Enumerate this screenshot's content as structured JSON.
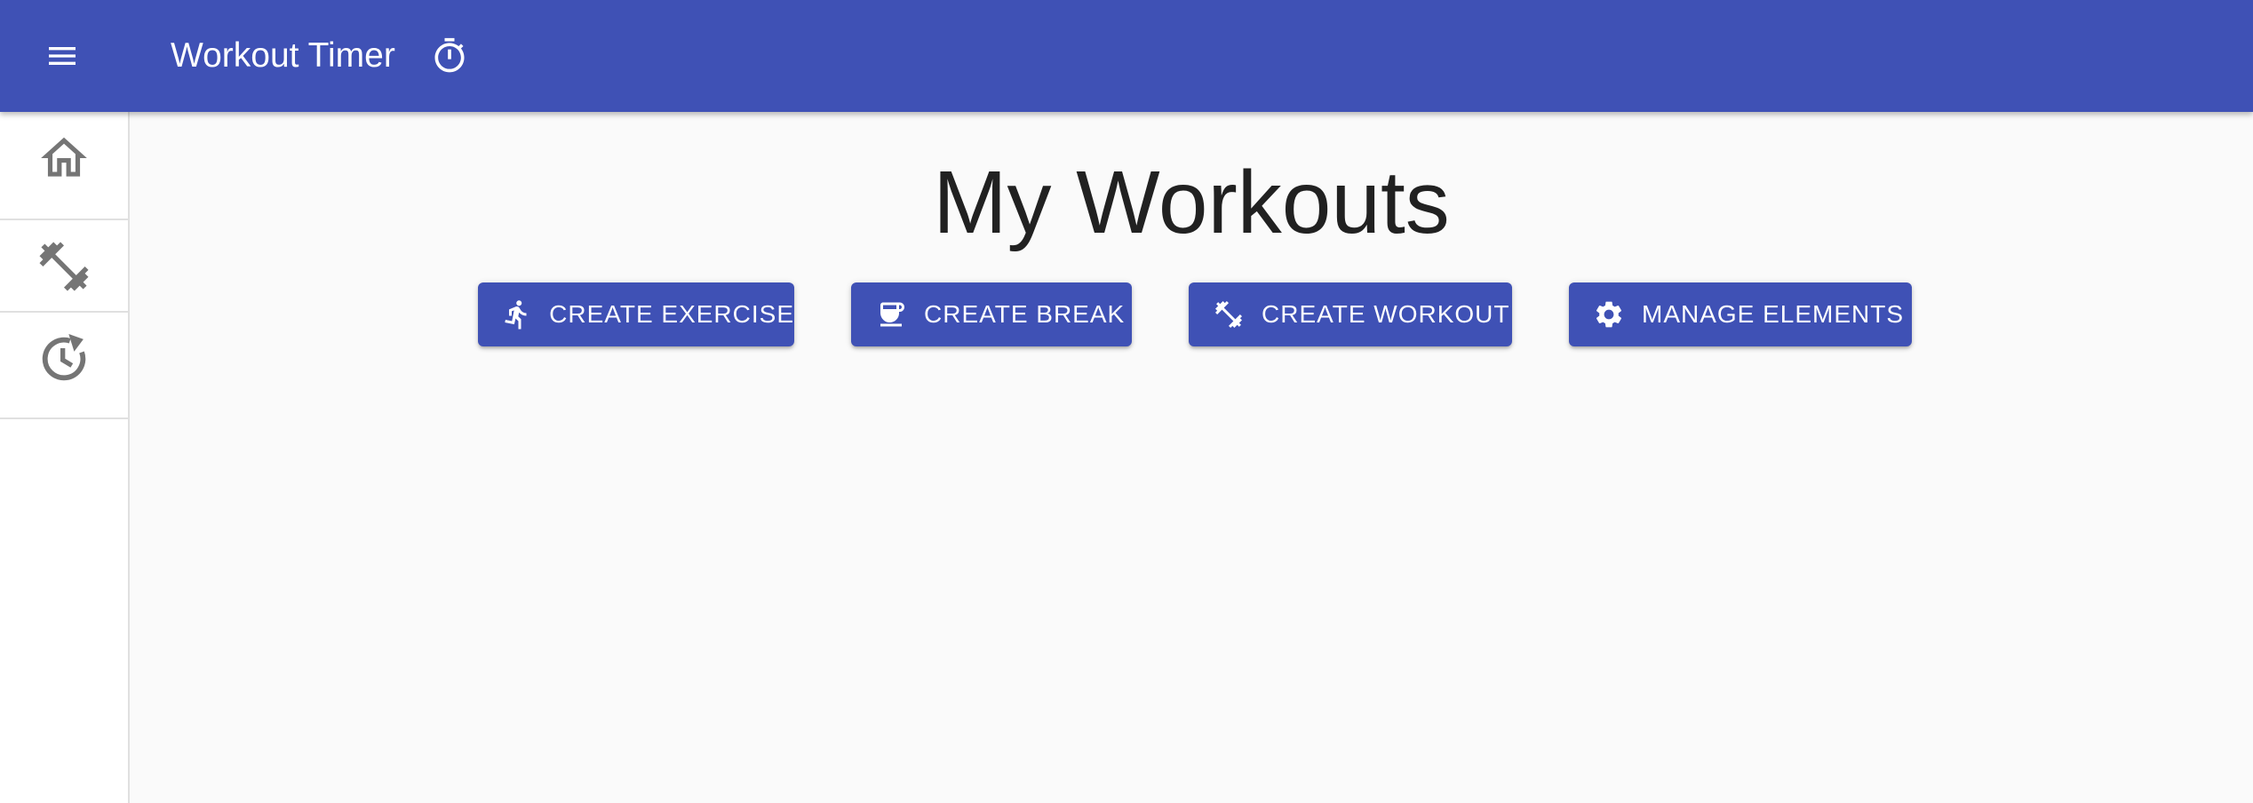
{
  "appbar": {
    "title": "Workout Timer",
    "menu_icon": "menu-icon",
    "title_icon": "timer-icon",
    "background_color": "#3f51b5"
  },
  "sidebar": {
    "items": [
      {
        "icon": "home-icon"
      },
      {
        "icon": "fitness-center-icon"
      },
      {
        "icon": "history-icon"
      }
    ]
  },
  "main": {
    "title": "My Workouts",
    "buttons": [
      {
        "label": "CREATE EXERCISE",
        "icon": "run-icon"
      },
      {
        "label": "CREATE BREAK",
        "icon": "coffee-icon"
      },
      {
        "label": "CREATE WORKOUT",
        "icon": "fitness-center-icon"
      },
      {
        "label": "MANAGE ELEMENTS",
        "icon": "gear-icon"
      }
    ]
  }
}
